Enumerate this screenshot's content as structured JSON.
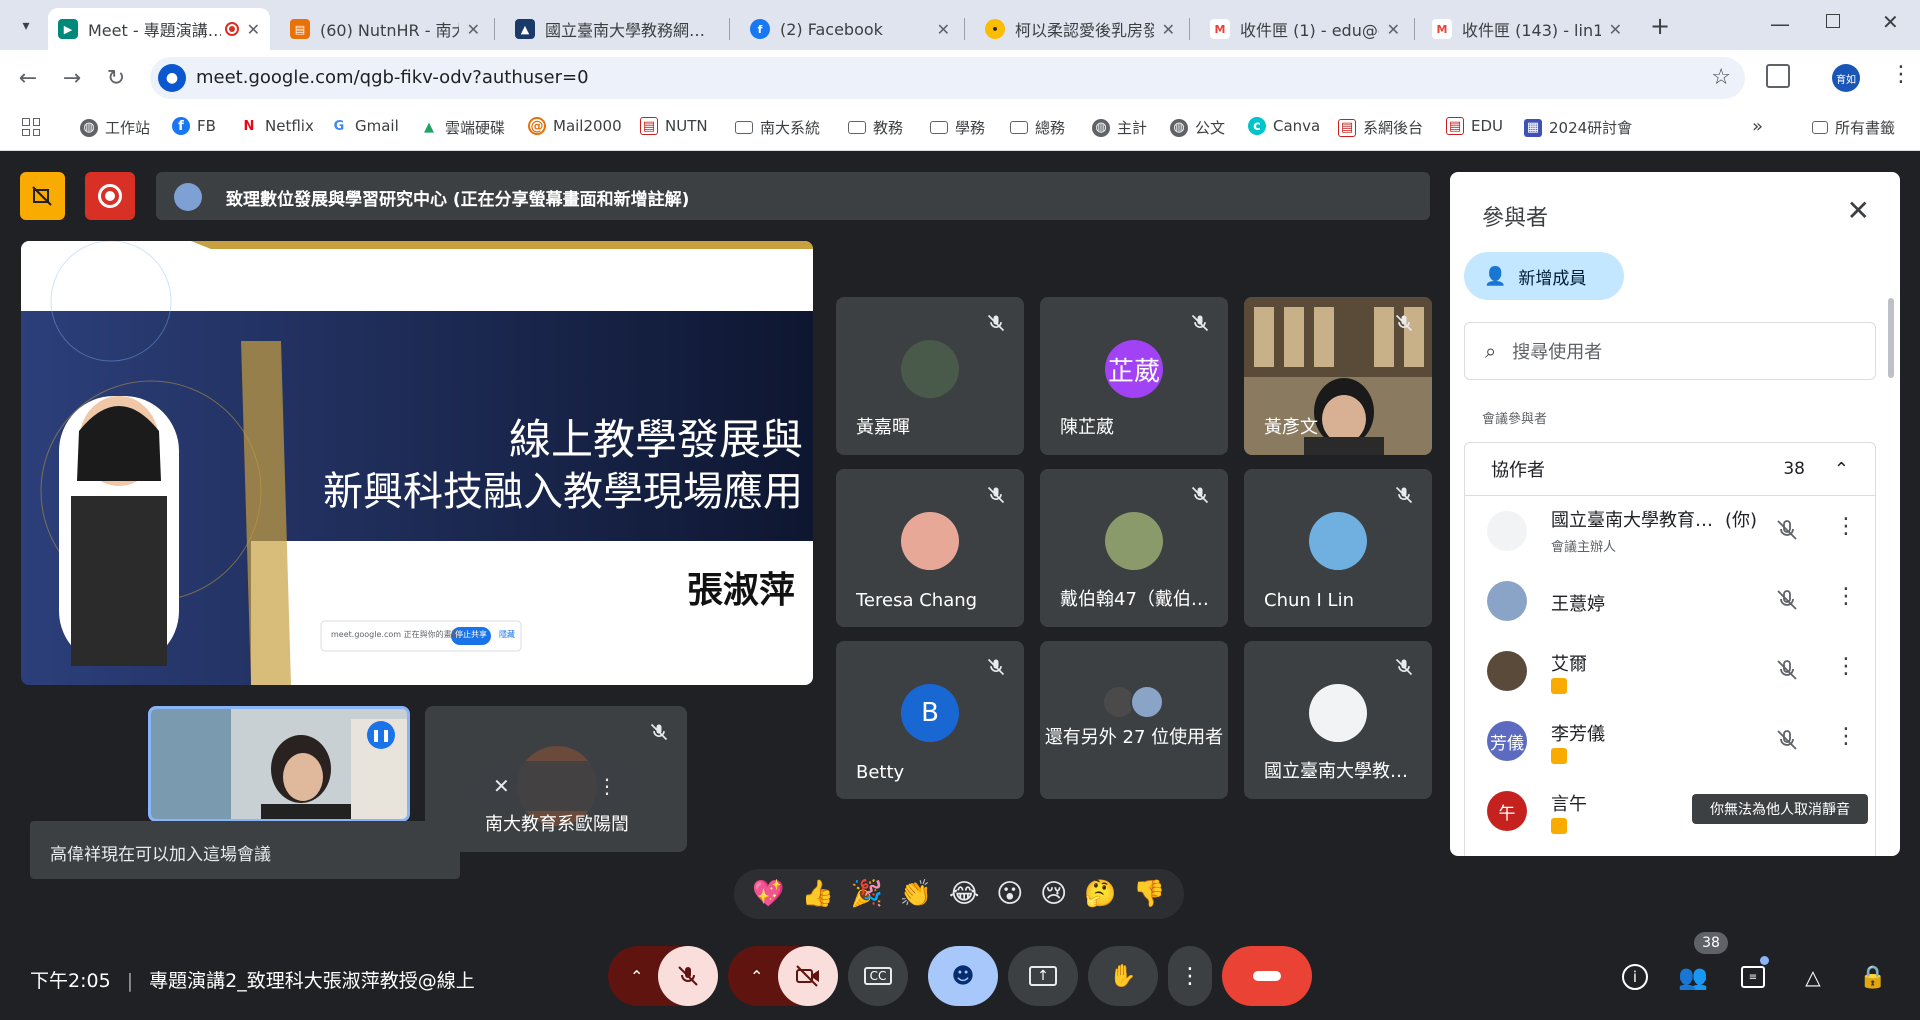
{
  "browser": {
    "tabs": [
      {
        "title": "Meet - 專題演講…",
        "favicon": "meet-icon",
        "active": true
      },
      {
        "title": "(60) NutnHR - 南大…",
        "favicon": "nutn-icon"
      },
      {
        "title": "國立臺南大學教務網…",
        "favicon": "school-icon"
      },
      {
        "title": "(2) Facebook",
        "favicon": "facebook-icon"
      },
      {
        "title": "柯以柔認愛後乳房發…",
        "favicon": "news-icon"
      },
      {
        "title": "收件匣 (1) - edu@g…",
        "favicon": "gmail-icon"
      },
      {
        "title": "收件匣 (143) - lin15…",
        "favicon": "gmail-icon"
      }
    ],
    "url": "meet.google.com/qgb-fikv-odv?authuser=0",
    "profile_label": "育如",
    "bookmarks": [
      {
        "label": "工作站",
        "icon": "globe-icon"
      },
      {
        "label": "FB",
        "icon": "facebook-icon"
      },
      {
        "label": "Netflix",
        "icon": "netflix-icon"
      },
      {
        "label": "Gmail",
        "icon": "google-icon"
      },
      {
        "label": "雲端硬碟",
        "icon": "drive-icon"
      },
      {
        "label": "Mail2000",
        "icon": "mail-icon"
      },
      {
        "label": "NUTN",
        "icon": "doc-icon"
      },
      {
        "label": "南大系統",
        "icon": "folder-icon"
      },
      {
        "label": "教務",
        "icon": "folder-icon"
      },
      {
        "label": "學務",
        "icon": "folder-icon"
      },
      {
        "label": "總務",
        "icon": "folder-icon"
      },
      {
        "label": "主計",
        "icon": "globe-icon"
      },
      {
        "label": "公文",
        "icon": "globe-icon"
      },
      {
        "label": "Canva",
        "icon": "canva-icon"
      },
      {
        "label": "系網後台",
        "icon": "doc-icon"
      },
      {
        "label": "EDU",
        "icon": "doc-icon"
      },
      {
        "label": "2024研討會",
        "icon": "calendar-icon"
      }
    ],
    "all_bookmarks": "所有書籤"
  },
  "meet": {
    "presenter_bar": "致理數位發展與學習研究中心 (正在分享螢幕畫面和新增註解)",
    "slide": {
      "line1": "線上教學發展與",
      "line2": "新興科技融入教學現場應用",
      "speaker": "張淑萍",
      "share_url": "meet.google.com 正在與你的畫面",
      "share_stop": "停止共享",
      "share_hide": "隱藏"
    },
    "tiles": [
      {
        "name": "黃嘉暉",
        "avatar_type": "photo",
        "color": "#4a5a4a"
      },
      {
        "name": "陳芷葳",
        "avatar_type": "initial",
        "initial": "芷葳",
        "color": "#a142f4"
      },
      {
        "name": "黃彥文",
        "avatar_type": "video",
        "color": "#6b5a48"
      },
      {
        "name": "Teresa Chang",
        "avatar_type": "photo",
        "color": "#e8a898"
      },
      {
        "name": "戴伯翰47（戴伯…",
        "avatar_type": "photo",
        "color": "#8a9a6a"
      },
      {
        "name": "Chun I Lin",
        "avatar_type": "photo",
        "color": "#6fb0e0"
      },
      {
        "name": "Betty",
        "avatar_type": "initial",
        "initial": "B",
        "color": "#1967d2"
      },
      {
        "name": "還有另外 27 位使用者",
        "avatar_type": "group",
        "color": "#5f6368"
      },
      {
        "name": "國立臺南大學教…",
        "avatar_type": "photo",
        "color": "#f1f3f4"
      }
    ],
    "self_tile_name": "南大教育系歐陽誾",
    "toast": "高偉祥現在可以加入這場會議",
    "reactions": [
      "💖",
      "👍",
      "🎉",
      "👏",
      "😂",
      "😮",
      "😢",
      "🤔",
      "👎"
    ],
    "clock": "下午2:05",
    "meeting_title": "專題演講2_致理科大張淑萍教授@線上",
    "participant_badge": "38"
  },
  "panel": {
    "title": "參與者",
    "add_member": "新增成員",
    "search_placeholder": "搜尋使用者",
    "section_label": "會議參與者",
    "group_label": "協作者",
    "group_count": "38",
    "participants": [
      {
        "name": "國立臺南大學教育…",
        "suffix": "(你)",
        "sub": "會議主辦人",
        "avatar_color": "#f1f3f4",
        "avatar_text": ""
      },
      {
        "name": "王薏婷",
        "sub": "",
        "avatar_color": "#8aa4c8",
        "avatar_text": ""
      },
      {
        "name": "艾爾",
        "sub": "",
        "avatar_color": "#5a4a3a",
        "avatar_text": "",
        "badge": true
      },
      {
        "name": "李芳儀",
        "sub": "",
        "avatar_color": "#5c6bc0",
        "avatar_text": "芳儀",
        "badge": true
      },
      {
        "name": "言午",
        "sub": "",
        "avatar_color": "#c5221f",
        "avatar_text": "午",
        "badge": true
      }
    ],
    "tooltip": "你無法為他人取消靜音"
  },
  "colors": {
    "meet_bg": "#202124",
    "tile_bg": "#3c4043",
    "leave_red": "#ea4335",
    "accent_blue": "#c2e7ff"
  }
}
